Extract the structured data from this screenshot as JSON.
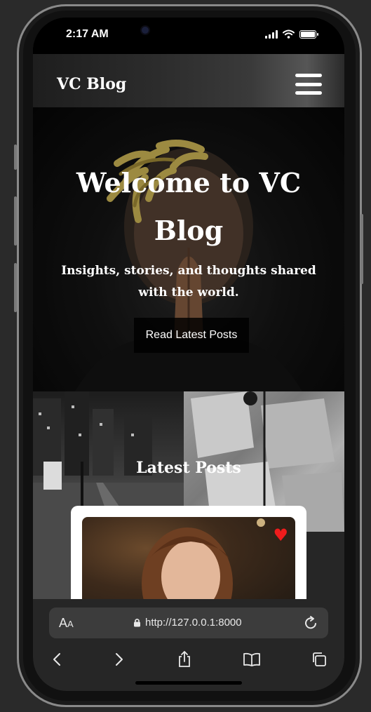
{
  "status_bar": {
    "time": "2:17 AM",
    "battery_level": 1.0
  },
  "nav": {
    "brand": "VC Blog"
  },
  "hero": {
    "title": "Welcome to VC Blog",
    "subtitle": "Insights, stories, and thoughts shared with the world.",
    "cta_label": "Read Latest Posts"
  },
  "posts": {
    "section_title": "Latest Posts"
  },
  "browser": {
    "aa_label_big": "A",
    "aa_label_small": "A",
    "url": "http://127.0.0.1:8000"
  },
  "colors": {
    "heart": "#ef1c1c",
    "page_bg": "#2a2a2a",
    "card_bg": "#ffffff"
  },
  "icons": [
    "lock-icon",
    "reload-icon",
    "back-icon",
    "forward-icon",
    "share-icon",
    "bookmarks-icon",
    "tabs-icon",
    "heart-icon",
    "menu-icon",
    "wifi-icon",
    "signal-icon",
    "battery-icon"
  ]
}
